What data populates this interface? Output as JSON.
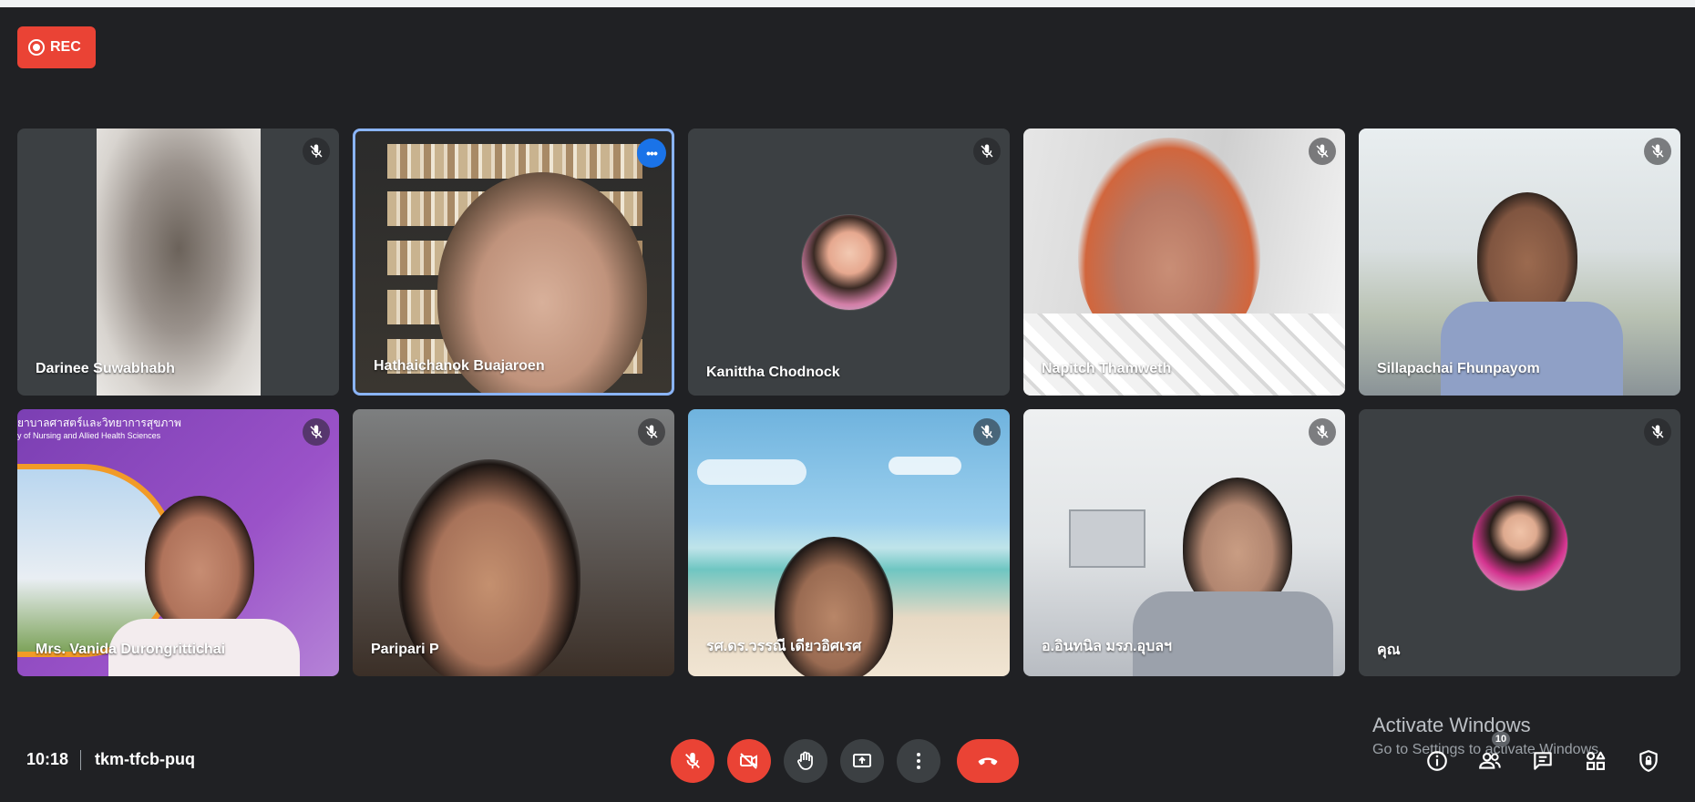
{
  "recording": {
    "label": "REC"
  },
  "participants": [
    {
      "name": "Darinee Suwabhabh",
      "muted": true,
      "video": "blurred-background"
    },
    {
      "name": "Hathaichanok Buajaroen",
      "muted": false,
      "video": "camera",
      "active_speaker": true
    },
    {
      "name": "Kanittha Chodnock",
      "muted": true,
      "video": "avatar"
    },
    {
      "name": "Napitch Thamweth",
      "muted": true,
      "video": "camera"
    },
    {
      "name": "Sillapachai Fhunpayom",
      "muted": true,
      "video": "camera"
    },
    {
      "name": "Mrs. Vanida Durongrittichai",
      "muted": true,
      "video": "camera"
    },
    {
      "name": "Paripari P",
      "muted": true,
      "video": "camera"
    },
    {
      "name": "รศ.ดร.วรรณี เดียวอิศเรศ",
      "muted": true,
      "video": "camera"
    },
    {
      "name": "อ.อินทนิล มรภ.อุบลฯ",
      "muted": true,
      "video": "camera"
    },
    {
      "name": "คุณ",
      "muted": true,
      "video": "avatar"
    }
  ],
  "tile_overlay": {
    "banner_line1": "ยาบาลศาสตร์และวิทยาการสุขภาพ",
    "banner_line2": "y of Nursing and Allied Health Sciences"
  },
  "meeting": {
    "time": "10:18",
    "code": "tkm-tfcb-puq"
  },
  "controls": [
    "mic-off",
    "camera-off",
    "raise-hand",
    "present",
    "more-options",
    "leave-call"
  ],
  "right_controls": [
    "meeting-details",
    "people",
    "chat",
    "activities",
    "host-controls"
  ],
  "people_count": "10",
  "watermark": {
    "line1": "Activate Windows",
    "line2": "Go to Settings to activate Windows."
  },
  "colors": {
    "background": "#202124",
    "tile": "#3c4043",
    "danger": "#ea4335",
    "active_border": "#8ab4f8"
  }
}
